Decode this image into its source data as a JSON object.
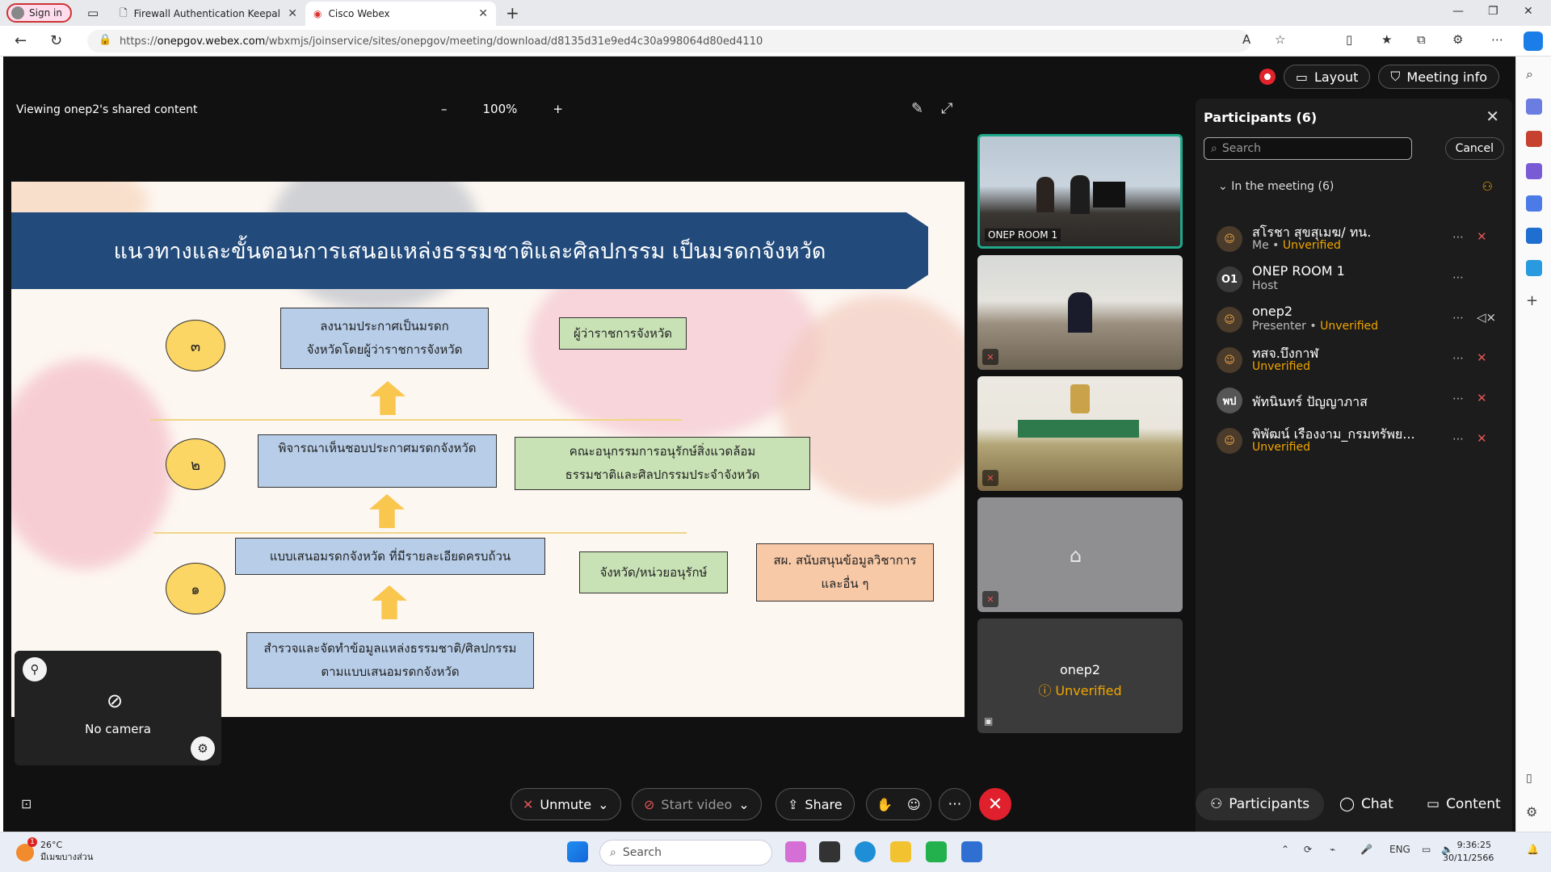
{
  "browser": {
    "signin_label": "Sign in",
    "tabs": [
      {
        "title": "Firewall Authentication Keepalive"
      },
      {
        "title": "Cisco Webex"
      }
    ],
    "url_prefix": "https://",
    "url_domain": "onepgov.webex.com",
    "url_path": "/wbxmjs/joinservice/sites/onepgov/meeting/download/d8135d31e9ed4c30a998064d80ed4110"
  },
  "meeting": {
    "layout_label": "Layout",
    "meeting_info_label": "Meeting info",
    "viewing_label": "Viewing onep2's shared content",
    "zoom_level": "100%",
    "zoom_minus": "–",
    "zoom_plus": "+"
  },
  "slide": {
    "title": "แนวทางและขั้นตอนการเสนอแหล่งธรรมชาติและศิลปกรรม เป็นมรดกจังหวัด",
    "steps": [
      "๓",
      "๒",
      "๑"
    ],
    "step3_box": "ลงนามประกาศเป็นมรดก\nจังหวัดโดยผู้ว่าราชการจังหวัด",
    "step3_actor": "ผู้ว่าราชการจังหวัด",
    "step2_box": "พิจารณาเห็นชอบประกาศมรดกจังหวัด",
    "step2_actor": "คณะอนุกรรมการอนุรักษ์สิ่งแวดล้อม\nธรรมชาติและศิลปกรรมประจำจังหวัด",
    "step1_box_top": "แบบเสนอมรดกจังหวัด ที่มีรายละเอียดครบถ้วน",
    "step1_box_bottom": "สำรวจและจัดทำข้อมูลแหล่งธรรมชาติ/ศิลปกรรม\nตามแบบเสนอมรดกจังหวัด",
    "step1_actor": "จังหวัด/หน่วยอนุรักษ์",
    "step1_support": "สผ. สนับสนุนข้อมูลวิชาการ\nและอื่น ๆ"
  },
  "self_view": {
    "label": "No camera"
  },
  "video_tiles": [
    {
      "label": "ONEP ROOM 1"
    },
    {
      "label": ""
    },
    {
      "label": ""
    },
    {
      "label": ""
    },
    {
      "name": "onep2",
      "status": "Unverified"
    }
  ],
  "participants": {
    "title": "Participants (6)",
    "search_placeholder": "Search",
    "cancel_label": "Cancel",
    "section_label": "In the meeting (6)",
    "list": [
      {
        "initials": "",
        "name": "สโรชา สุขสุเมฆ/ ทน.",
        "role": "Me",
        "status": "Unverified"
      },
      {
        "initials": "O1",
        "name": "ONEP ROOM 1",
        "role": "Host",
        "status": ""
      },
      {
        "initials": "",
        "name": "onep2",
        "role": "Presenter",
        "status": "Unverified"
      },
      {
        "initials": "",
        "name": "ทสจ.บึงกาฬ",
        "role": "",
        "status": "Unverified"
      },
      {
        "initials": "พป",
        "name": "พัทนินทร์ ปัญญาภาส",
        "role": "",
        "status": ""
      },
      {
        "initials": "",
        "name": "พิพัฒน์ เรืองงาม_กรมทรัพย...",
        "role": "",
        "status": "Unverified"
      }
    ]
  },
  "controls": {
    "unmute_label": "Unmute",
    "start_video_label": "Start video",
    "share_label": "Share",
    "participants_label": "Participants",
    "chat_label": "Chat",
    "content_label": "Content"
  },
  "taskbar": {
    "temperature": "26°C",
    "weather_desc": "มีเมฆบางส่วน",
    "search_label": "Search",
    "lang": "ENG",
    "time": "9:36:25",
    "date": "30/11/2566"
  },
  "colors": {
    "banner": "#224b7c",
    "step_circle": "#fbd665",
    "box_blue": "#b7cde8",
    "box_green": "#c8e1b5",
    "box_orange": "#f8c9a7",
    "end_call": "#e0202c",
    "unverified": "#f0a500"
  }
}
